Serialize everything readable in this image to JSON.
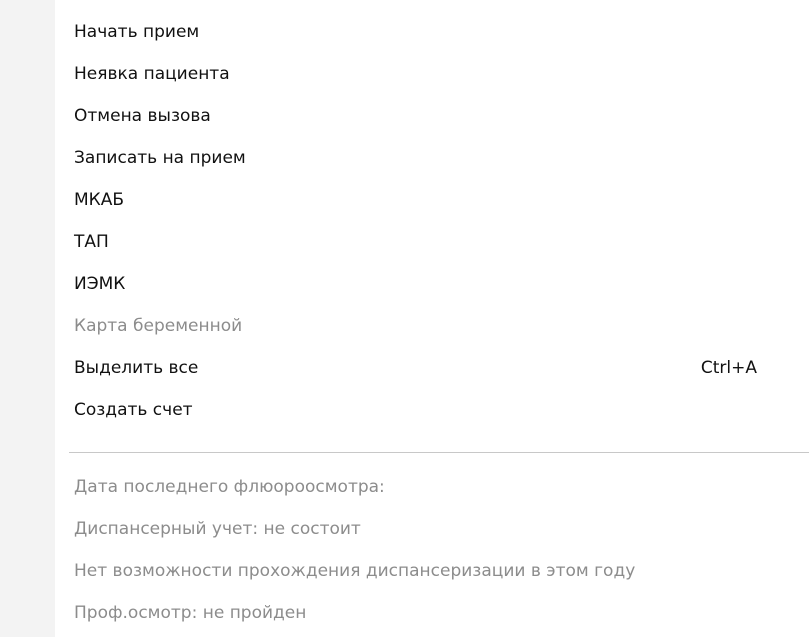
{
  "context_menu": {
    "items": [
      {
        "label": "Начать прием"
      },
      {
        "label": "Неявка пациента"
      },
      {
        "label": "Отмена вызова"
      },
      {
        "label": "Записать на прием"
      },
      {
        "label": "МКАБ"
      },
      {
        "label": "ТАП"
      },
      {
        "label": "ИЭМК"
      },
      {
        "label": "Карта беременной"
      },
      {
        "label": "Выделить все",
        "shortcut": "Ctrl+A"
      },
      {
        "label": "Создать счет"
      }
    ],
    "info": [
      {
        "label": "Дата последнего флюороосмотра:"
      },
      {
        "label": "Диспансерный учет: не состоит"
      },
      {
        "label": "Нет возможности прохождения диспансеризации в этом году"
      },
      {
        "label": "Проф.осмотр: не пройден"
      }
    ]
  }
}
